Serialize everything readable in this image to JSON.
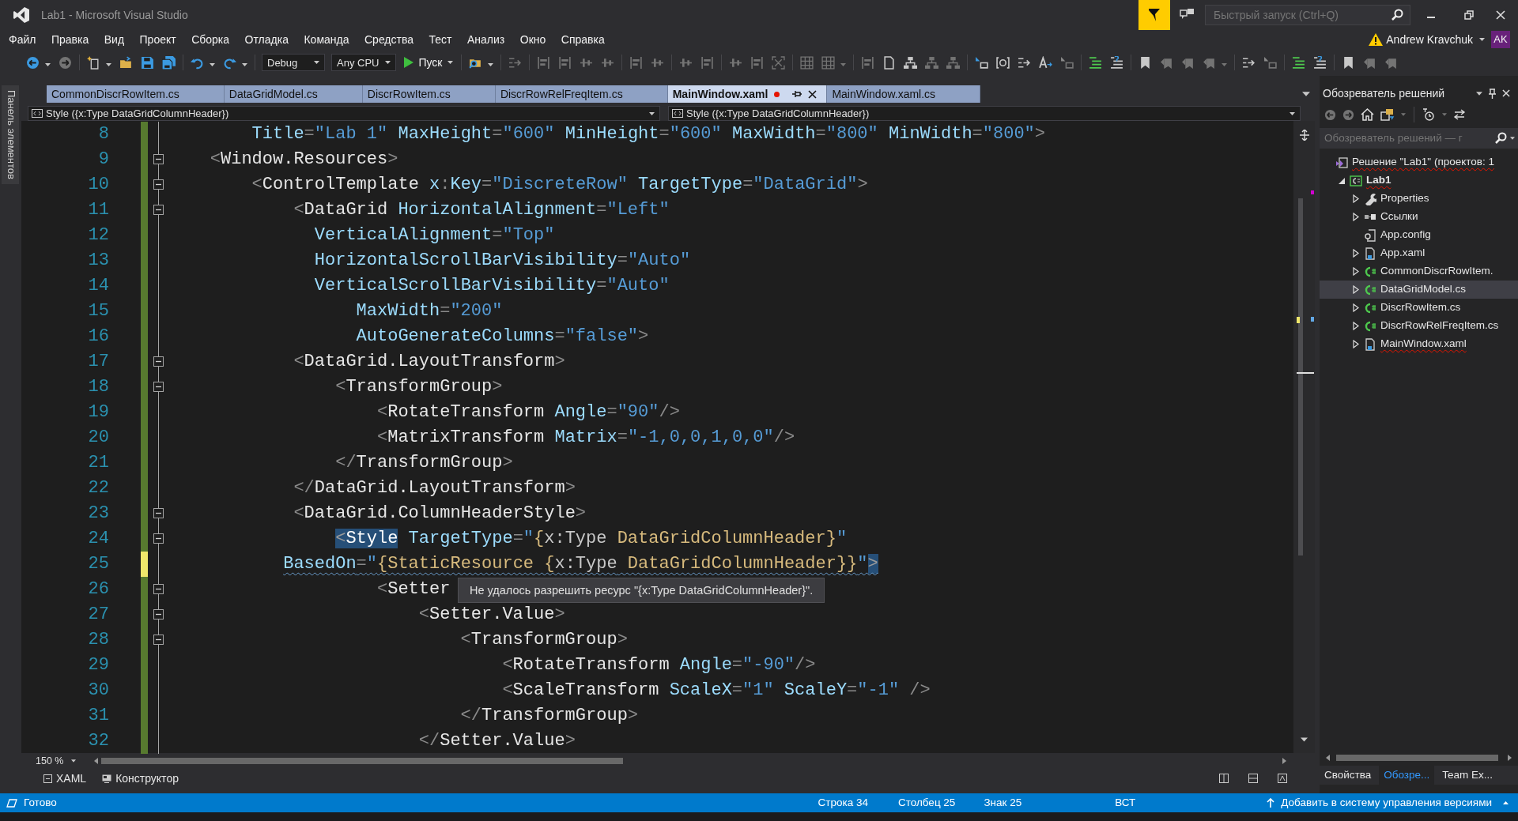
{
  "window": {
    "title": "Lab1 - Microsoft Visual Studio"
  },
  "quick_launch": {
    "placeholder": "Быстрый запуск (Ctrl+Q)"
  },
  "menu": [
    "Файл",
    "Правка",
    "Вид",
    "Проект",
    "Сборка",
    "Отладка",
    "Команда",
    "Средства",
    "Тест",
    "Анализ",
    "Окно",
    "Справка"
  ],
  "account": {
    "name": "Andrew Kravchuk",
    "initials": "AK",
    "warning": true
  },
  "toolbar": [
    {
      "kind": "back",
      "disabled": false
    },
    {
      "kind": "caret",
      "disabled": false
    },
    {
      "kind": "forward",
      "disabled": true
    },
    {
      "kind": "separator"
    },
    {
      "kind": "new-project",
      "disabled": false
    },
    {
      "kind": "caret",
      "disabled": false
    },
    {
      "kind": "open",
      "disabled": false
    },
    {
      "kind": "save",
      "disabled": false
    },
    {
      "kind": "save-all",
      "disabled": false
    },
    {
      "kind": "separator"
    },
    {
      "kind": "undo",
      "disabled": false
    },
    {
      "kind": "caret",
      "disabled": false
    },
    {
      "kind": "redo",
      "disabled": false
    },
    {
      "kind": "caret",
      "disabled": false
    },
    {
      "kind": "separator"
    },
    {
      "kind": "combo",
      "value": "Debug"
    },
    {
      "kind": "combo",
      "value": "Any CPU"
    },
    {
      "kind": "run",
      "label": "Пуск"
    },
    {
      "kind": "separator"
    },
    {
      "kind": "find",
      "disabled": false
    },
    {
      "kind": "caret",
      "disabled": false
    },
    {
      "kind": "separator"
    },
    {
      "kind": "step",
      "disabled": true
    },
    {
      "kind": "separator"
    },
    {
      "kind": "align",
      "disabled": true
    },
    {
      "kind": "align",
      "disabled": true
    },
    {
      "kind": "bars",
      "disabled": true
    },
    {
      "kind": "bars",
      "disabled": true
    },
    {
      "kind": "separator"
    },
    {
      "kind": "align",
      "disabled": true
    },
    {
      "kind": "bars",
      "disabled": true
    },
    {
      "kind": "separator"
    },
    {
      "kind": "bars",
      "disabled": true
    },
    {
      "kind": "align",
      "disabled": true
    },
    {
      "kind": "separator"
    },
    {
      "kind": "bars",
      "disabled": true
    },
    {
      "kind": "align",
      "disabled": true
    },
    {
      "kind": "resize",
      "disabled": true
    },
    {
      "kind": "separator"
    },
    {
      "kind": "grid",
      "disabled": true
    },
    {
      "kind": "grid",
      "disabled": true
    },
    {
      "kind": "caret",
      "disabled": true
    },
    {
      "kind": "separator"
    },
    {
      "kind": "align",
      "disabled": true
    },
    {
      "kind": "doc",
      "disabled": false
    },
    {
      "kind": "tree",
      "disabled": false
    },
    {
      "kind": "tree",
      "disabled": true
    },
    {
      "kind": "tree",
      "disabled": true
    },
    {
      "kind": "separator"
    },
    {
      "kind": "indent",
      "disabled": false
    },
    {
      "kind": "at",
      "disabled": false
    },
    {
      "kind": "step",
      "disabled": false
    },
    {
      "kind": "format",
      "disabled": false
    },
    {
      "kind": "indent",
      "disabled": true
    },
    {
      "kind": "separator"
    },
    {
      "kind": "comment",
      "disabled": false
    },
    {
      "kind": "uncomment",
      "disabled": false
    },
    {
      "kind": "separator"
    },
    {
      "kind": "bookmark",
      "disabled": false
    },
    {
      "kind": "bookmark-nav",
      "disabled": true
    },
    {
      "kind": "bookmark-nav",
      "disabled": true
    },
    {
      "kind": "bookmark-nav",
      "disabled": true
    },
    {
      "kind": "caret",
      "disabled": true
    },
    {
      "kind": "separator"
    },
    {
      "kind": "step",
      "disabled": false
    },
    {
      "kind": "indent",
      "disabled": true
    },
    {
      "kind": "separator"
    },
    {
      "kind": "comment",
      "disabled": false
    },
    {
      "kind": "uncomment",
      "disabled": false
    },
    {
      "kind": "separator"
    },
    {
      "kind": "bookmark",
      "disabled": false
    },
    {
      "kind": "bookmark-nav",
      "disabled": true
    },
    {
      "kind": "bookmark-nav",
      "disabled": true
    }
  ],
  "toolbox_tab": "Панель элементов",
  "tabs": [
    {
      "label": "CommonDiscrRowItem.cs",
      "selected": false,
      "modified": false
    },
    {
      "label": "DataGridModel.cs",
      "selected": false,
      "modified": false
    },
    {
      "label": "DiscrRowItem.cs",
      "selected": false,
      "modified": false
    },
    {
      "label": "DiscrRowRelFreqItem.cs",
      "selected": false,
      "modified": false
    },
    {
      "label": "MainWindow.xaml",
      "selected": true,
      "modified": true
    },
    {
      "label": "MainWindow.xaml.cs",
      "selected": false,
      "modified": false
    }
  ],
  "nav_bar": [
    "Style ({x:Type DataGridColumnHeader})",
    "Style ({x:Type DataGridColumnHeader})"
  ],
  "editor": {
    "lines": [
      {
        "number": "8",
        "unsaved": false,
        "fold": false,
        "error": false,
        "tokens": [
          {
            "kind": "at",
            "text": "        Title"
          },
          {
            "kind": "br",
            "text": "="
          },
          {
            "kind": "val",
            "text": "\"Lab 1\""
          },
          {
            "kind": "at",
            "text": " MaxHeight"
          },
          {
            "kind": "br",
            "text": "="
          },
          {
            "kind": "val",
            "text": "\"600\""
          },
          {
            "kind": "at",
            "text": " MinHeight"
          },
          {
            "kind": "br",
            "text": "="
          },
          {
            "kind": "val",
            "text": "\"600\""
          },
          {
            "kind": "at",
            "text": " MaxWidth"
          },
          {
            "kind": "br",
            "text": "="
          },
          {
            "kind": "val",
            "text": "\"800\""
          },
          {
            "kind": "at",
            "text": " MinWidth"
          },
          {
            "kind": "br",
            "text": "="
          },
          {
            "kind": "val",
            "text": "\"800\""
          },
          {
            "kind": "br",
            "text": ">"
          }
        ]
      },
      {
        "number": "9",
        "unsaved": false,
        "fold": true,
        "error": false,
        "tokens": [
          {
            "kind": "br",
            "text": "    <"
          },
          {
            "kind": "el",
            "text": "Window.Resources"
          },
          {
            "kind": "br",
            "text": ">"
          }
        ]
      },
      {
        "number": "10",
        "unsaved": false,
        "fold": true,
        "error": false,
        "tokens": [
          {
            "kind": "br",
            "text": "        <"
          },
          {
            "kind": "el",
            "text": "ControlTemplate"
          },
          {
            "kind": "at",
            "text": " x"
          },
          {
            "kind": "br",
            "text": ":"
          },
          {
            "kind": "at",
            "text": "Key"
          },
          {
            "kind": "br",
            "text": "="
          },
          {
            "kind": "val",
            "text": "\"DiscreteRow\""
          },
          {
            "kind": "at",
            "text": " TargetType"
          },
          {
            "kind": "br",
            "text": "="
          },
          {
            "kind": "val",
            "text": "\"DataGrid\""
          },
          {
            "kind": "br",
            "text": ">"
          }
        ]
      },
      {
        "number": "11",
        "unsaved": false,
        "fold": true,
        "error": false,
        "tokens": [
          {
            "kind": "br",
            "text": "            <"
          },
          {
            "kind": "el",
            "text": "DataGrid"
          },
          {
            "kind": "at",
            "text": " HorizontalAlignment"
          },
          {
            "kind": "br",
            "text": "="
          },
          {
            "kind": "val",
            "text": "\"Left\""
          }
        ]
      },
      {
        "number": "12",
        "unsaved": false,
        "fold": false,
        "error": false,
        "tokens": [
          {
            "kind": "at",
            "text": "              VerticalAlignment"
          },
          {
            "kind": "br",
            "text": "="
          },
          {
            "kind": "val",
            "text": "\"Top\""
          }
        ]
      },
      {
        "number": "13",
        "unsaved": false,
        "fold": false,
        "error": false,
        "tokens": [
          {
            "kind": "at",
            "text": "              HorizontalScrollBarVisibility"
          },
          {
            "kind": "br",
            "text": "="
          },
          {
            "kind": "val",
            "text": "\"Auto\""
          }
        ]
      },
      {
        "number": "14",
        "unsaved": false,
        "fold": false,
        "error": false,
        "tokens": [
          {
            "kind": "at",
            "text": "              VerticalScrollBarVisibility"
          },
          {
            "kind": "br",
            "text": "="
          },
          {
            "kind": "val",
            "text": "\"Auto\""
          }
        ]
      },
      {
        "number": "15",
        "unsaved": false,
        "fold": false,
        "error": false,
        "tokens": [
          {
            "kind": "at",
            "text": "                  MaxWidth"
          },
          {
            "kind": "br",
            "text": "="
          },
          {
            "kind": "val",
            "text": "\"200\""
          }
        ]
      },
      {
        "number": "16",
        "unsaved": false,
        "fold": false,
        "error": false,
        "tokens": [
          {
            "kind": "at",
            "text": "                  AutoGenerateColumns"
          },
          {
            "kind": "br",
            "text": "="
          },
          {
            "kind": "val",
            "text": "\"false\""
          },
          {
            "kind": "br",
            "text": ">"
          }
        ]
      },
      {
        "number": "17",
        "unsaved": false,
        "fold": true,
        "error": false,
        "tokens": [
          {
            "kind": "br",
            "text": "            <"
          },
          {
            "kind": "el",
            "text": "DataGrid.LayoutTransform"
          },
          {
            "kind": "br",
            "text": ">"
          }
        ]
      },
      {
        "number": "18",
        "unsaved": false,
        "fold": true,
        "error": false,
        "tokens": [
          {
            "kind": "br",
            "text": "                <"
          },
          {
            "kind": "el",
            "text": "TransformGroup"
          },
          {
            "kind": "br",
            "text": ">"
          }
        ]
      },
      {
        "number": "19",
        "unsaved": false,
        "fold": false,
        "error": false,
        "tokens": [
          {
            "kind": "br",
            "text": "                    <"
          },
          {
            "kind": "el",
            "text": "RotateTransform"
          },
          {
            "kind": "at",
            "text": " Angle"
          },
          {
            "kind": "br",
            "text": "="
          },
          {
            "kind": "val",
            "text": "\"90\""
          },
          {
            "kind": "br",
            "text": "/>"
          }
        ]
      },
      {
        "number": "20",
        "unsaved": false,
        "fold": false,
        "error": false,
        "tokens": [
          {
            "kind": "br",
            "text": "                    <"
          },
          {
            "kind": "el",
            "text": "MatrixTransform"
          },
          {
            "kind": "at",
            "text": " Matrix"
          },
          {
            "kind": "br",
            "text": "="
          },
          {
            "kind": "val",
            "text": "\"-1,0,0,1,0,0\""
          },
          {
            "kind": "br",
            "text": "/>"
          }
        ]
      },
      {
        "number": "21",
        "unsaved": false,
        "fold": false,
        "error": false,
        "tokens": [
          {
            "kind": "br",
            "text": "                </"
          },
          {
            "kind": "el",
            "text": "TransformGroup"
          },
          {
            "kind": "br",
            "text": ">"
          }
        ]
      },
      {
        "number": "22",
        "unsaved": false,
        "fold": false,
        "error": false,
        "tokens": [
          {
            "kind": "br",
            "text": "            </"
          },
          {
            "kind": "el",
            "text": "DataGrid.LayoutTransform"
          },
          {
            "kind": "br",
            "text": ">"
          }
        ]
      },
      {
        "number": "23",
        "unsaved": false,
        "fold": true,
        "error": false,
        "tokens": [
          {
            "kind": "br",
            "text": "            <"
          },
          {
            "kind": "el",
            "text": "DataGrid.ColumnHeaderStyle"
          },
          {
            "kind": "br",
            "text": ">"
          }
        ]
      },
      {
        "number": "24",
        "unsaved": false,
        "fold": true,
        "error": false,
        "tokens": [
          {
            "kind": "br-hl",
            "text": "                <"
          },
          {
            "kind": "el-hl",
            "text": "Style"
          },
          {
            "kind": "at",
            "text": " TargetType"
          },
          {
            "kind": "br",
            "text": "="
          },
          {
            "kind": "val",
            "text": "\""
          },
          {
            "kind": "ext",
            "text": "{"
          },
          {
            "kind": "mk",
            "text": "x:Type"
          },
          {
            "kind": "ext",
            "text": " DataGridColumnHeader}"
          },
          {
            "kind": "val",
            "text": "\""
          }
        ]
      },
      {
        "number": "25",
        "unsaved": true,
        "fold": false,
        "error": true,
        "tokens": [
          {
            "kind": "at",
            "text": "           BasedOn"
          },
          {
            "kind": "br",
            "text": "="
          },
          {
            "kind": "val",
            "text": "\""
          },
          {
            "kind": "ext",
            "text": "{StaticResource {"
          },
          {
            "kind": "mk",
            "text": "x:Type"
          },
          {
            "kind": "ext",
            "text": " DataGridColumnHeader}}"
          },
          {
            "kind": "val",
            "text": "\""
          },
          {
            "kind": "br-hl",
            "text": ">"
          }
        ]
      },
      {
        "number": "26",
        "unsaved": false,
        "fold": true,
        "error": false,
        "tokens": [
          {
            "kind": "br",
            "text": "                    <"
          },
          {
            "kind": "el",
            "text": "Setter"
          }
        ]
      },
      {
        "number": "27",
        "unsaved": false,
        "fold": true,
        "error": false,
        "tokens": [
          {
            "kind": "br",
            "text": "                        <"
          },
          {
            "kind": "el",
            "text": "Setter.Value"
          },
          {
            "kind": "br",
            "text": ">"
          }
        ]
      },
      {
        "number": "28",
        "unsaved": false,
        "fold": true,
        "error": false,
        "tokens": [
          {
            "kind": "br",
            "text": "                            <"
          },
          {
            "kind": "el",
            "text": "TransformGroup"
          },
          {
            "kind": "br",
            "text": ">"
          }
        ]
      },
      {
        "number": "29",
        "unsaved": false,
        "fold": false,
        "error": false,
        "tokens": [
          {
            "kind": "br",
            "text": "                                <"
          },
          {
            "kind": "el",
            "text": "RotateTransform"
          },
          {
            "kind": "at",
            "text": " Angle"
          },
          {
            "kind": "br",
            "text": "="
          },
          {
            "kind": "val",
            "text": "\"-90\""
          },
          {
            "kind": "br",
            "text": "/>"
          }
        ]
      },
      {
        "number": "30",
        "unsaved": false,
        "fold": false,
        "error": false,
        "tokens": [
          {
            "kind": "br",
            "text": "                                <"
          },
          {
            "kind": "el",
            "text": "ScaleTransform"
          },
          {
            "kind": "at",
            "text": " ScaleX"
          },
          {
            "kind": "br",
            "text": "="
          },
          {
            "kind": "val",
            "text": "\"1\""
          },
          {
            "kind": "at",
            "text": " ScaleY"
          },
          {
            "kind": "br",
            "text": "="
          },
          {
            "kind": "val",
            "text": "\"-1\""
          },
          {
            "kind": "br",
            "text": " />"
          }
        ]
      },
      {
        "number": "31",
        "unsaved": false,
        "fold": false,
        "error": false,
        "tokens": [
          {
            "kind": "br",
            "text": "                            </"
          },
          {
            "kind": "el",
            "text": "TransformGroup"
          },
          {
            "kind": "br",
            "text": ">"
          }
        ]
      },
      {
        "number": "32",
        "unsaved": false,
        "fold": false,
        "error": false,
        "tokens": [
          {
            "kind": "br",
            "text": "                        </"
          },
          {
            "kind": "el",
            "text": "Setter.Value"
          },
          {
            "kind": "br",
            "text": ">"
          }
        ]
      }
    ],
    "tooltip": "Не удалось разрешить ресурс \"{x:Type DataGridColumnHeader}\"."
  },
  "zoom": "150 %",
  "views": [
    "XAML",
    "Конструктор"
  ],
  "solution_explorer": {
    "title": "Обозреватель решений",
    "search": {
      "placeholder": "Обозреватель решений — г"
    },
    "tree": [
      {
        "label": "Решение \"Lab1\" (проектов: 1",
        "kind": "solution",
        "expandable": false,
        "selected": false,
        "error": true,
        "children": [
          {
            "label": "Lab1",
            "kind": "project",
            "expandable": true,
            "expanded": true,
            "selected": false,
            "error": true,
            "children": [
              {
                "label": "Properties",
                "kind": "properties",
                "expandable": true,
                "expanded": false,
                "selected": false,
                "error": false
              },
              {
                "label": "Ссылки",
                "kind": "references",
                "expandable": true,
                "expanded": false,
                "selected": false,
                "error": false
              },
              {
                "label": "App.config",
                "kind": "config",
                "expandable": false,
                "selected": false,
                "error": false
              },
              {
                "label": "App.xaml",
                "kind": "xaml",
                "expandable": true,
                "expanded": false,
                "selected": false,
                "error": false
              },
              {
                "label": "CommonDiscrRowItem.",
                "kind": "cs",
                "expandable": true,
                "expanded": false,
                "selected": false,
                "error": false
              },
              {
                "label": "DataGridModel.cs",
                "kind": "cs",
                "expandable": true,
                "expanded": false,
                "selected": true,
                "error": false
              },
              {
                "label": "DiscrRowItem.cs",
                "kind": "cs",
                "expandable": true,
                "expanded": false,
                "selected": false,
                "error": false
              },
              {
                "label": "DiscrRowRelFreqItem.cs",
                "kind": "cs",
                "expandable": true,
                "expanded": false,
                "selected": false,
                "error": false
              },
              {
                "label": "MainWindow.xaml",
                "kind": "xaml",
                "expandable": true,
                "expanded": false,
                "selected": false,
                "error": true
              }
            ]
          }
        ]
      }
    ]
  },
  "panel_tabs": [
    {
      "label": "Свойства",
      "selected": false
    },
    {
      "label": "Обозре...",
      "selected": true
    },
    {
      "label": "Team Ex...",
      "selected": false
    }
  ],
  "status_bar": {
    "message": "Готово",
    "line": "Строка 34",
    "column": "Столбец 25",
    "char": "Знак 25",
    "mode": "ВСТ",
    "source_control": "Добавить в систему управления версиями"
  }
}
